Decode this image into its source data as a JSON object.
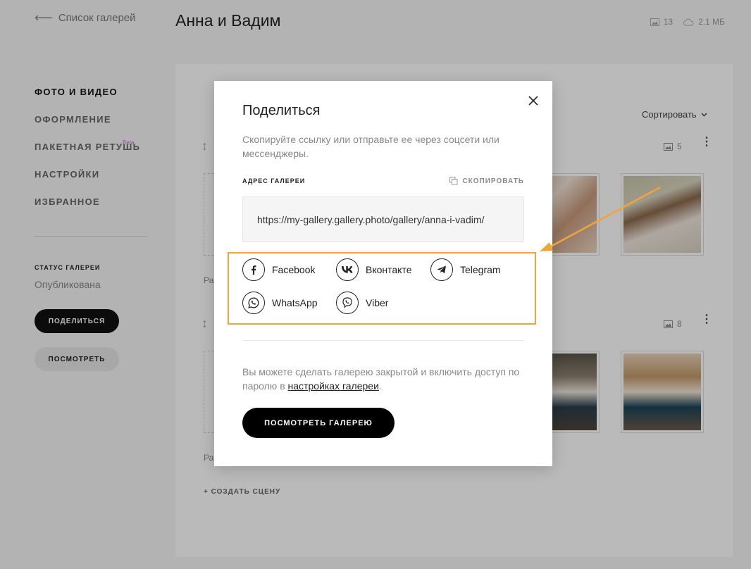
{
  "header": {
    "back_label": "Список галерей",
    "title": "Анна и Вадим",
    "photo_count": "13",
    "storage": "2.1 МБ"
  },
  "sidebar": {
    "items": [
      {
        "label": "ФОТО И ВИДЕО",
        "active": true
      },
      {
        "label": "ОФОРМЛЕНИЕ"
      },
      {
        "label": "ПАКЕТНАЯ РЕТУШЬ",
        "badge": "Beta"
      },
      {
        "label": "НАСТРОЙКИ"
      },
      {
        "label": "ИЗБРАННОЕ"
      }
    ],
    "status_label": "СТАТУС ГАЛЕРЕИ",
    "status_value": "Опубликована",
    "share_button": "ПОДЕЛИТЬСЯ",
    "view_button": "ПОСМОТРЕТЬ"
  },
  "main": {
    "sort_label": "Сортировать",
    "scenes": [
      {
        "count": "5",
        "label_prefix": "Ра"
      },
      {
        "count": "8",
        "label_prefix": "Ра"
      }
    ],
    "create_scene": "+ СОЗДАТЬ СЦЕНУ"
  },
  "modal": {
    "title": "Поделиться",
    "description": "Скопируйте ссылку или отправьте ее через соцсети или мессенджеры.",
    "address_label": "АДРЕС ГАЛЕРЕИ",
    "copy_label": "СКОПИРОВАТЬ",
    "url": "https://my-gallery.gallery.photo/gallery/anna-i-vadim/",
    "social": [
      {
        "label": "Facebook",
        "icon": "facebook-icon"
      },
      {
        "label": "Вконтакте",
        "icon": "vk-icon"
      },
      {
        "label": "Telegram",
        "icon": "telegram-icon"
      },
      {
        "label": "WhatsApp",
        "icon": "whatsapp-icon"
      },
      {
        "label": "Viber",
        "icon": "viber-icon"
      }
    ],
    "note_text": "Вы можете сделать галерею закрытой и включить доступ по паролю в ",
    "note_link": "настройках галереи",
    "note_end": ".",
    "view_gallery_button": "ПОСМОТРЕТЬ ГАЛЕРЕЮ"
  },
  "colors": {
    "highlight": "#f0a53a",
    "primary": "#000000",
    "beta_badge": "#c76ac6"
  }
}
